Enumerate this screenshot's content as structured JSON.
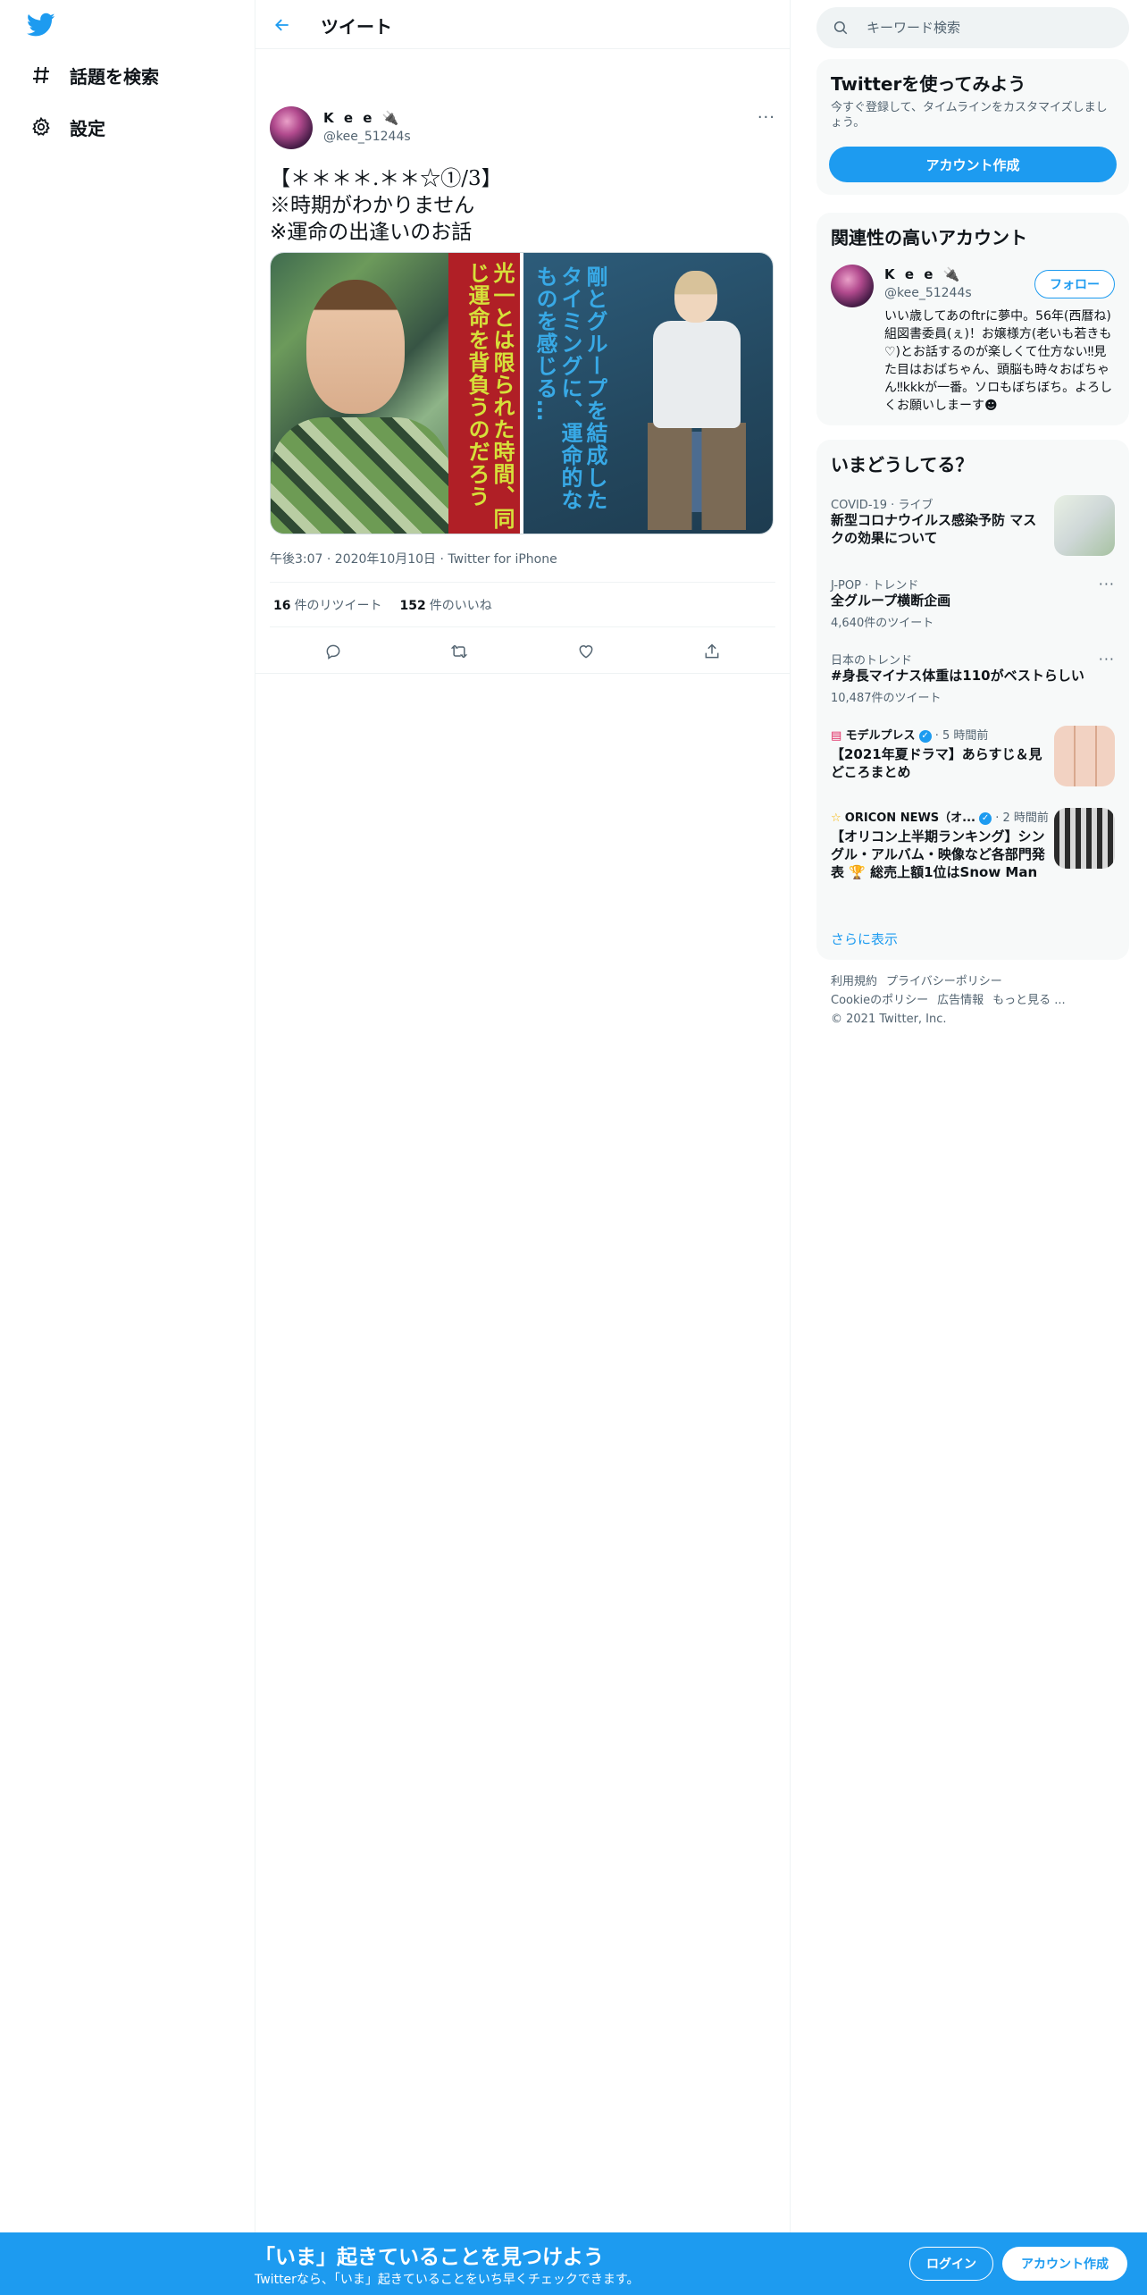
{
  "nav": {
    "items": [
      {
        "label": "話題を検索",
        "icon": "hashtag-icon"
      },
      {
        "label": "設定",
        "icon": "gear-icon"
      }
    ]
  },
  "header": {
    "title": "ツイート"
  },
  "tweet": {
    "name": "K e e 🔌",
    "handle": "@kee_51244s",
    "text": "【＊＊＊＊.＊＊☆①/3】\n※時期がわかりません\n※運命の出逢いのお話",
    "image_text_left": "光一とは限られた時間、同じ運命を背負うのだろう",
    "image_text_right": "剛とグループを結成したタイミングに、運命的なものを感じる…",
    "meta": "午後3:07 · 2020年10月10日 · Twitter for iPhone",
    "retweets": "16",
    "retweets_label": "件のリツイート",
    "likes": "152",
    "likes_label": "件のいいね"
  },
  "search": {
    "placeholder": "キーワード検索"
  },
  "signup_card": {
    "title": "Twitterを使ってみよう",
    "sub": "今すぐ登録して、タイムラインをカスタマイズしましょう。",
    "button": "アカウント作成"
  },
  "related": {
    "title": "関連性の高いアカウント",
    "name": "K e e 🔌",
    "handle": "@kee_51244s",
    "follow": "フォロー",
    "bio": "いい歳してあのftrに夢中。56年(西暦ね)組図書委員(ぇ)！お嬢様方(老いも若きも♡)とお話するのが楽しくて仕方ない‼見た目はおばちゃん、頭脳も時々おばちゃん‼kkkが一番。ソロもぼちぼち。よろしくお願いしまーす☻"
  },
  "trends": {
    "title": "いまどうしてる？",
    "items": [
      {
        "context": "COVID-19 · ライブ",
        "title": "新型コロナウイルス感染予防 マスクの効果について"
      },
      {
        "context": "J-POP · トレンド",
        "title": "全グループ横断企画",
        "count": "4,640件のツイート"
      },
      {
        "context": "日本のトレンド",
        "title": "#身長マイナス体重は110がベストらしい",
        "count": "10,487件のツイート"
      },
      {
        "context": "モデルプレス",
        "time": "· 5 時間前",
        "title": "【2021年夏ドラマ】あらすじ＆見どころまとめ"
      },
      {
        "context": "ORICON NEWS（オ...",
        "time": "· 2 時間前",
        "title": "【オリコン上半期ランキング】シングル・アルバム・映像など各部門発表 🏆 総売上額1位はSnow Man"
      }
    ],
    "more": "さらに表示"
  },
  "footer": {
    "links": [
      "利用規約",
      "プライバシーポリシー",
      "Cookieのポリシー",
      "広告情報",
      "もっと見る ..."
    ],
    "copyright": "© 2021 Twitter, Inc."
  },
  "bottom_bar": {
    "title": "「いま」起きていることを見つけよう",
    "sub": "Twitterなら、「いま」起きていることをいち早くチェックできます。",
    "login": "ログイン",
    "signup": "アカウント作成"
  },
  "colors": {
    "accent": "#1d9bf0",
    "text": "#0f1419",
    "muted": "#536471"
  }
}
